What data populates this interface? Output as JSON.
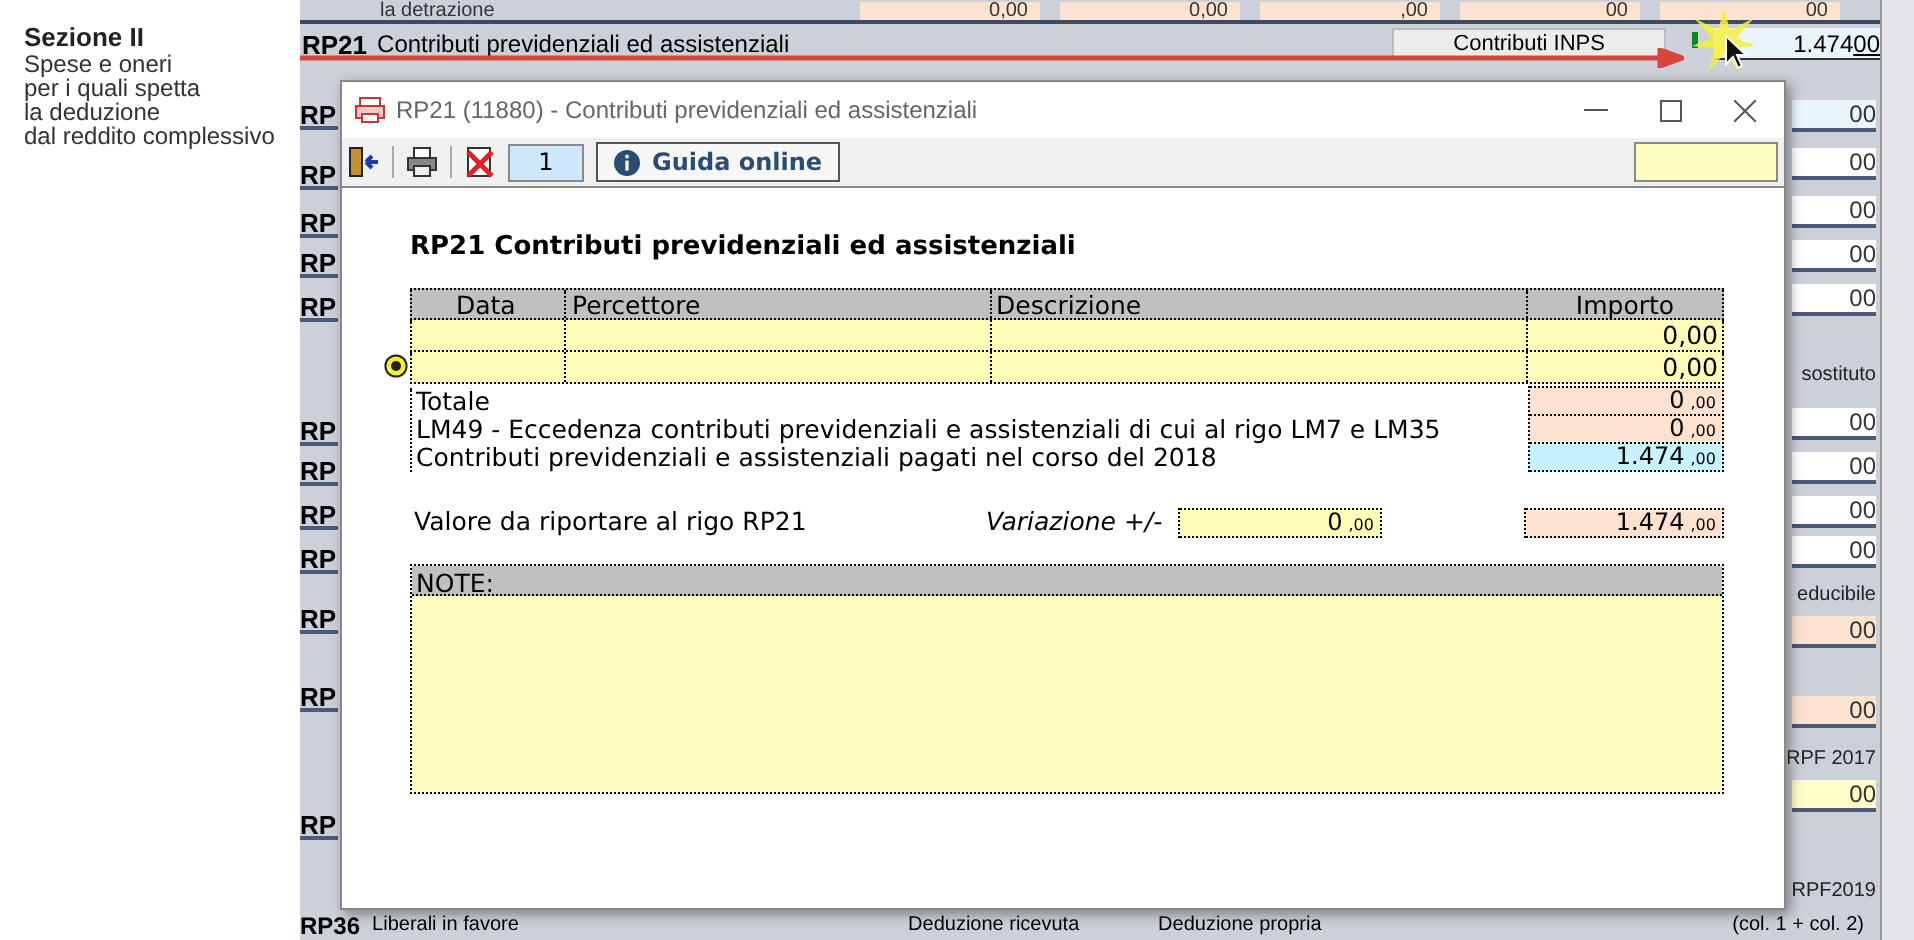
{
  "form": {
    "top_caption": "la detrazione",
    "top_values": [
      "0,00",
      "0,00",
      ",00",
      "00",
      "00"
    ],
    "section": {
      "title": "Sezione II",
      "lines": [
        "Spese e oneri",
        "per i quali spetta",
        "la deduzione",
        "dal reddito complessivo"
      ]
    },
    "rp21": {
      "code": "RP21",
      "label": "Contributi previdenziali ed assistenziali",
      "button": "Contributi INPS",
      "value": "1.474",
      "decimals": "00"
    },
    "row_codes": [
      "RP",
      "RP",
      "RP",
      "RP",
      "RP",
      "RP",
      "RP",
      "RP",
      "RP",
      "RP",
      "RP",
      "RP"
    ],
    "right_column": [
      {
        "kind": "field",
        "text": "00",
        "color": "#e8f6fb"
      },
      {
        "kind": "field",
        "text": "00",
        "color": "#ffffff"
      },
      {
        "kind": "field",
        "text": "00",
        "color": "#ffffff"
      },
      {
        "kind": "field",
        "text": "00",
        "color": "#ffffff"
      },
      {
        "kind": "field",
        "text": "00",
        "color": "#ffffff"
      },
      {
        "kind": "label",
        "text": "sostituto"
      },
      {
        "kind": "field",
        "text": "00",
        "color": "#ffffff"
      },
      {
        "kind": "field",
        "text": "00",
        "color": "#ffffff"
      },
      {
        "kind": "field",
        "text": "00",
        "color": "#ffffff"
      },
      {
        "kind": "field",
        "text": "00",
        "color": "#ffffff"
      },
      {
        "kind": "label",
        "text": "educibile"
      },
      {
        "kind": "field",
        "text": "00",
        "color": "#fde3cf"
      },
      {
        "kind": "field",
        "text": "00",
        "color": "#fde3cf"
      },
      {
        "kind": "label",
        "text": "RPF 2017"
      },
      {
        "kind": "field",
        "text": "00",
        "color": "#fffdc8"
      },
      {
        "kind": "label",
        "text": "RPF2019"
      }
    ],
    "bottom": {
      "code": "RP36",
      "label": "Liberali in favore",
      "columns": [
        "Deduzione ricevuta",
        "Deduzione propria"
      ],
      "total_label": "(col. 1 + col. 2)"
    }
  },
  "dialog": {
    "title": "RP21 (11880) - Contributi previdenziali ed assistenziali",
    "toolbar": {
      "counter": "1",
      "help": "Guida online"
    },
    "heading": "RP21 Contributi previdenziali ed assistenziali",
    "table": {
      "columns": [
        "Data",
        "Percettore",
        "Descrizione",
        "Importo"
      ],
      "rows": [
        [
          "",
          "",
          "",
          "0,00"
        ],
        [
          "",
          "",
          "",
          "0,00"
        ]
      ]
    },
    "summary": [
      {
        "label": "Totale",
        "value": "0",
        "decimals": ",00",
        "color": "#fde3cf"
      },
      {
        "label": "LM49 - Eccedenza contributi previdenziali e assistenziali di cui al rigo LM7 e LM35",
        "value": "0",
        "decimals": ",00",
        "color": "#fde3cf"
      },
      {
        "label": "Contributi previdenziali e assistenziali pagati nel corso del 2018",
        "value": "1.474",
        "decimals": ",00",
        "color": "#c9f3fc"
      }
    ],
    "result": {
      "label": "Valore da riportare al rigo RP21",
      "variation_label": "Variazione +/-",
      "variation": "0",
      "variation_decimals": ",00",
      "value": "1.474",
      "decimals": ",00"
    },
    "notes": {
      "label": "NOTE:"
    }
  }
}
